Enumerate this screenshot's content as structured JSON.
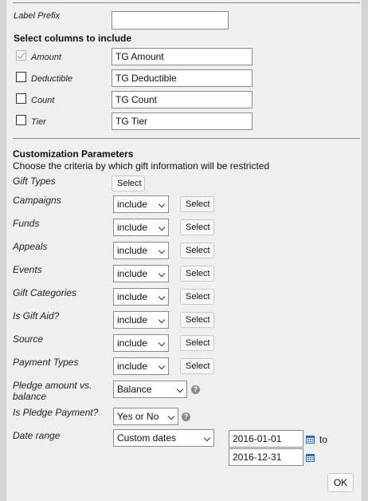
{
  "label_prefix": {
    "label": "Label Prefix",
    "value": ""
  },
  "columns": {
    "heading": "Select columns to include",
    "items": [
      {
        "label": "Amount",
        "checked": true,
        "value": "TG Amount"
      },
      {
        "label": "Deductible",
        "checked": false,
        "value": "TG Deductible"
      },
      {
        "label": "Count",
        "checked": false,
        "value": "TG Count"
      },
      {
        "label": "Tier",
        "checked": false,
        "value": "TG Tier"
      }
    ]
  },
  "customization": {
    "heading": "Customization Parameters",
    "description": "Choose the criteria by which gift information will be restricted"
  },
  "select_label": "Select",
  "parameters": {
    "gift_types": {
      "label": "Gift Types"
    },
    "campaigns": {
      "label": "Campaigns",
      "mode": "include"
    },
    "funds": {
      "label": "Funds",
      "mode": "include"
    },
    "appeals": {
      "label": "Appeals",
      "mode": "include"
    },
    "events": {
      "label": "Events",
      "mode": "include"
    },
    "gift_categories": {
      "label": "Gift Categories",
      "mode": "include"
    },
    "is_gift_aid": {
      "label": "Is Gift Aid?",
      "mode": "include"
    },
    "source": {
      "label": "Source",
      "mode": "include"
    },
    "payment_types": {
      "label": "Payment Types",
      "mode": "include"
    },
    "pledge_amount": {
      "label_line1": "Pledge amount vs.",
      "label_line2": "balance",
      "value": "Balance"
    },
    "is_pledge_payment": {
      "label": "Is Pledge Payment?",
      "value": "Yes or No"
    },
    "date_range": {
      "label": "Date range",
      "value": "Custom dates",
      "start": "2016-01-01",
      "end": "2016-12-31",
      "to_label": "to"
    }
  },
  "help_glyph": "?",
  "ok_label": "OK",
  "colors": {
    "background": "#efefef",
    "outer": "#d4d4d4",
    "calendar_icon": "#2a6ab8"
  }
}
